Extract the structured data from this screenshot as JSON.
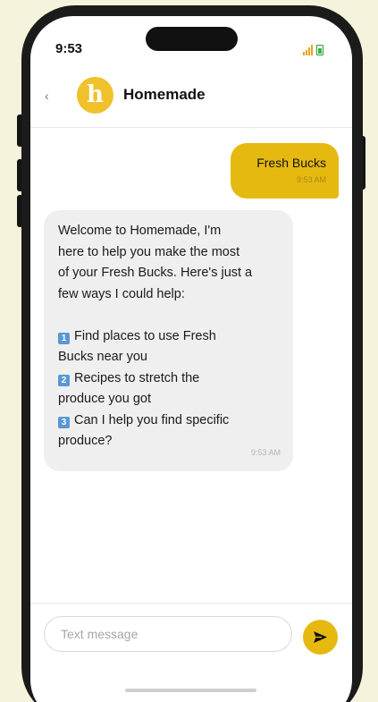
{
  "status_bar": {
    "time": "9:53"
  },
  "header": {
    "avatar_letter": "h",
    "title": "Homemade"
  },
  "messages": {
    "outgoing": {
      "text": "Fresh Bucks",
      "time": "9:53 AM"
    },
    "incoming": {
      "lines": [
        "Welcome to Homemade, I'm",
        "here to help you make the most",
        "of your Fresh Bucks. Here's just a",
        "few ways I could help:"
      ],
      "items": [
        {
          "num": "1",
          "line1": "Find places to use Fresh",
          "line2": "Bucks near you"
        },
        {
          "num": "2",
          "line1": "Recipes to stretch the",
          "line2": "produce you got"
        },
        {
          "num": "3",
          "line1": "Can I help you find specific",
          "line2": "produce?"
        }
      ],
      "time": "9:53 AM"
    }
  },
  "composer": {
    "placeholder": "Text message"
  },
  "colors": {
    "accent": "#e6b910",
    "background": "#f6f3dc",
    "incoming_bubble": "#efefef"
  },
  "icons": {
    "back": "chevron-left-icon",
    "send": "send-arrow-icon",
    "signal": "cellular-signal-icon",
    "battery": "battery-icon"
  }
}
